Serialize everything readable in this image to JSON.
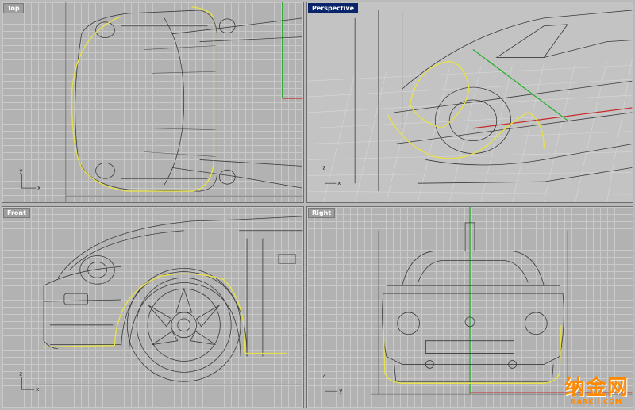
{
  "viewports": {
    "top": {
      "label": "Top",
      "active": false
    },
    "perspective": {
      "label": "Perspective",
      "active": true
    },
    "front": {
      "label": "Front",
      "active": false
    },
    "right": {
      "label": "Right",
      "active": false
    }
  },
  "axis_triad": {
    "x_label": "x",
    "y_label": "y",
    "z_label": "z"
  },
  "colors": {
    "active_label_bg": "#0a246a",
    "selected_curve": "#e6e04a",
    "x_axis": "#c42b2b",
    "y_axis": "#1fae2a",
    "watermark": "#ff8a00"
  },
  "watermark": {
    "main": "纳金网",
    "sub": "NARKII.COM"
  },
  "icons": [
    "axis-triad-icon"
  ]
}
